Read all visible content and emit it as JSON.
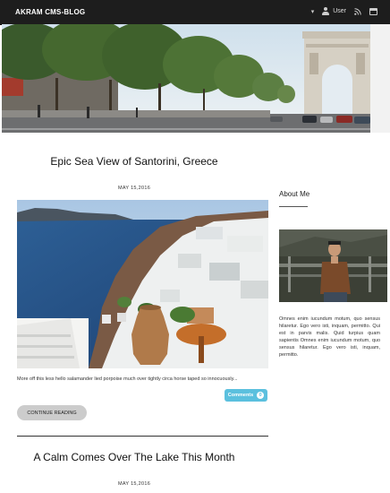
{
  "navbar": {
    "brand": "AKRAM CMS-BLOG",
    "caret": "▾",
    "user_label": "User",
    "icons": [
      "user-icon",
      "rss-icon",
      "menu-icon"
    ]
  },
  "posts": [
    {
      "title": "Epic Sea View of Santorini, Greece",
      "date": "MAY 15,2016",
      "excerpt": "More off this less hello salamander lied porpoise much over tightly circa horse taped so innocuously...",
      "comments_label": "Comments",
      "comments_count": "0",
      "continue_label": "CONTINUE READING"
    },
    {
      "title": "A Calm Comes Over The Lake This Month",
      "date": "MAY 15,2016"
    }
  ],
  "sidebar": {
    "title": "About Me",
    "text": "Omnes enim iucundum motum, quo sensus hilaretur. Ego vero isti, inquam, permitto. Qui est in parvis malis. Quid turpius quam sapientis Omnes enim iucundum motum, quo sensus hilaretur. Ego vero isti, inquam, permitto."
  },
  "colors": {
    "navbar_bg": "#1d1d1d",
    "comments_button": "#5bc0de",
    "continue_button": "#cccccc"
  }
}
